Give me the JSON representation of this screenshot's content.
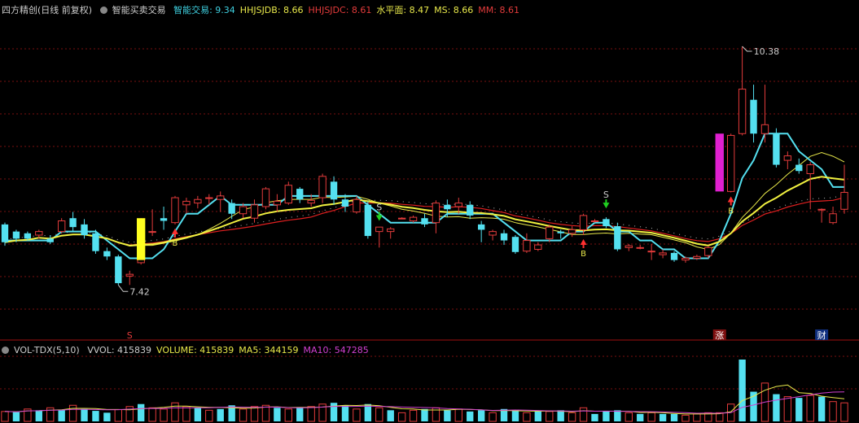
{
  "main_header": {
    "title": "四方精创(日线 前复权)",
    "indicator": "智能买卖交易",
    "items": [
      {
        "label": "智能交易:",
        "value": "9.34",
        "color": "#3fd0e0"
      },
      {
        "label": "HHJSJDB:",
        "value": "8.66",
        "color": "#e8e84a"
      },
      {
        "label": "HHJSJDC:",
        "value": "8.61",
        "color": "#e33b3b"
      },
      {
        "label": "水平面:",
        "value": "8.47",
        "color": "#e8e84a"
      },
      {
        "label": "MS:",
        "value": "8.66",
        "color": "#e8e84a"
      },
      {
        "label": "MM:",
        "value": "8.61",
        "color": "#e33b3b"
      }
    ]
  },
  "vol_header": {
    "indicator": "VOL-TDX(5,10)",
    "items": [
      {
        "label": "VVOL:",
        "value": "415839",
        "color": "#cccccc"
      },
      {
        "label": "VOLUME:",
        "value": "415839",
        "color": "#e8e84a"
      },
      {
        "label": "MA5:",
        "value": "344159",
        "color": "#e8e84a"
      },
      {
        "label": "MA10:",
        "value": "547285",
        "color": "#d040d0"
      }
    ]
  },
  "annotations": {
    "high_label": "10.38",
    "low_label": "7.42",
    "sell_label": "S",
    "buy_label": "B",
    "marker_s": "S",
    "marker_zhang": "涨",
    "marker_cai": "财"
  },
  "colors": {
    "up": "#e33b3b",
    "down": "#54e0f0",
    "cyan_line": "#54e0f0",
    "yellow_line": "#f0f040",
    "red_line": "#e02020",
    "grid": "#7a1010",
    "magenta": "#e020d0"
  },
  "chart_data": {
    "type": "candlestick",
    "candles": [
      [
        8.38,
        8.4,
        8.18,
        8.14
      ],
      [
        8.3,
        8.32,
        8.22,
        8.18
      ],
      [
        8.28,
        8.3,
        8.22,
        8.2
      ],
      [
        8.26,
        8.32,
        8.3,
        8.22
      ],
      [
        8.22,
        8.26,
        8.18,
        8.16
      ],
      [
        8.3,
        8.45,
        8.42,
        8.28
      ],
      [
        8.45,
        8.52,
        8.35,
        8.3
      ],
      [
        8.38,
        8.44,
        8.26,
        8.22
      ],
      [
        8.28,
        8.32,
        8.08,
        8.05
      ],
      [
        8.08,
        8.12,
        8.02,
        7.98
      ],
      [
        8.02,
        8.04,
        7.72,
        7.7
      ],
      [
        7.8,
        7.86,
        7.82,
        7.7
      ],
      [
        7.95,
        8.45,
        8.3,
        7.93
      ],
      [
        8.3,
        8.55,
        8.3,
        8.25
      ],
      [
        8.45,
        8.58,
        8.42,
        8.32
      ],
      [
        8.4,
        8.7,
        8.68,
        8.38
      ],
      [
        8.6,
        8.68,
        8.64,
        8.5
      ],
      [
        8.62,
        8.7,
        8.66,
        8.56
      ],
      [
        8.68,
        8.72,
        8.68,
        8.6
      ],
      [
        8.66,
        8.75,
        8.7,
        8.52
      ],
      [
        8.62,
        8.66,
        8.5,
        8.44
      ],
      [
        8.5,
        8.62,
        8.58,
        8.45
      ],
      [
        8.45,
        8.66,
        8.6,
        8.4
      ],
      [
        8.58,
        8.8,
        8.78,
        8.55
      ],
      [
        8.6,
        8.72,
        8.64,
        8.52
      ],
      [
        8.62,
        8.86,
        8.82,
        8.6
      ],
      [
        8.78,
        8.8,
        8.66,
        8.62
      ],
      [
        8.62,
        8.72,
        8.65,
        8.58
      ],
      [
        8.68,
        8.95,
        8.92,
        8.62
      ],
      [
        8.86,
        8.92,
        8.66,
        8.6
      ],
      [
        8.66,
        8.72,
        8.58,
        8.52
      ],
      [
        8.52,
        8.7,
        8.66,
        8.5
      ],
      [
        8.6,
        8.64,
        8.25,
        8.22
      ],
      [
        8.3,
        8.32,
        8.35,
        8.12
      ],
      [
        8.3,
        8.35,
        8.33,
        8.22
      ],
      [
        8.45,
        8.46,
        8.45,
        8.44
      ],
      [
        8.42,
        8.48,
        8.46,
        8.4
      ],
      [
        8.45,
        8.5,
        8.38,
        8.35
      ],
      [
        8.4,
        8.65,
        8.62,
        8.28
      ],
      [
        8.6,
        8.66,
        8.55,
        8.46
      ],
      [
        8.58,
        8.68,
        8.62,
        8.5
      ],
      [
        8.6,
        8.64,
        8.48,
        8.44
      ],
      [
        8.38,
        8.42,
        8.32,
        8.18
      ],
      [
        8.26,
        8.32,
        8.3,
        8.2
      ],
      [
        8.28,
        8.32,
        8.2,
        8.15
      ],
      [
        8.24,
        8.26,
        8.07,
        8.05
      ],
      [
        8.08,
        8.28,
        8.2,
        8.06
      ],
      [
        8.1,
        8.18,
        8.15,
        8.08
      ],
      [
        8.22,
        8.38,
        8.35,
        8.18
      ],
      [
        8.3,
        8.32,
        8.28,
        8.22
      ],
      [
        8.28,
        8.36,
        8.32,
        8.24
      ],
      [
        8.32,
        8.5,
        8.48,
        8.26
      ],
      [
        8.42,
        8.44,
        8.42,
        8.4
      ],
      [
        8.44,
        8.46,
        8.36,
        8.34
      ],
      [
        8.36,
        8.4,
        8.1,
        8.08
      ],
      [
        8.12,
        8.16,
        8.14,
        8.08
      ],
      [
        8.12,
        8.15,
        8.12,
        8.1
      ],
      [
        8.08,
        8.16,
        8.08,
        7.98
      ],
      [
        8.04,
        8.1,
        8.06,
        8.0
      ],
      [
        8.06,
        8.08,
        7.98,
        7.96
      ],
      [
        7.98,
        8.02,
        8.0,
        7.95
      ],
      [
        8.0,
        8.04,
        8.02,
        7.98
      ],
      [
        8.03,
        8.14,
        8.12,
        8.0
      ],
      [
        8.9,
        8.94,
        8.92,
        8.88
      ],
      [
        8.75,
        9.4,
        9.38,
        8.74
      ],
      [
        9.4,
        10.38,
        9.9,
        9.38
      ],
      [
        9.78,
        9.95,
        9.4,
        9.3
      ],
      [
        9.4,
        9.95,
        9.5,
        9.3
      ],
      [
        9.4,
        9.46,
        9.05,
        9.02
      ],
      [
        9.1,
        9.2,
        9.15,
        9.0
      ],
      [
        9.05,
        9.12,
        8.98,
        8.95
      ],
      [
        8.95,
        9.08,
        9.05,
        8.55
      ],
      [
        8.55,
        8.56,
        8.55,
        8.4
      ],
      [
        8.4,
        8.58,
        8.5,
        8.38
      ],
      [
        8.55,
        9.05,
        8.74,
        8.5
      ]
    ],
    "volume_scale_max": 100,
    "volumes": [
      [
        16,
        0
      ],
      [
        15,
        1
      ],
      [
        20,
        0
      ],
      [
        18,
        1
      ],
      [
        22,
        0
      ],
      [
        19,
        1
      ],
      [
        26,
        0
      ],
      [
        20,
        1
      ],
      [
        17,
        1
      ],
      [
        14,
        1
      ],
      [
        19,
        0
      ],
      [
        24,
        0
      ],
      [
        28,
        1
      ],
      [
        22,
        0
      ],
      [
        20,
        0
      ],
      [
        30,
        0
      ],
      [
        24,
        0
      ],
      [
        22,
        1
      ],
      [
        18,
        0
      ],
      [
        20,
        1
      ],
      [
        26,
        1
      ],
      [
        20,
        0
      ],
      [
        24,
        0
      ],
      [
        26,
        0
      ],
      [
        22,
        1
      ],
      [
        20,
        0
      ],
      [
        22,
        1
      ],
      [
        24,
        0
      ],
      [
        28,
        0
      ],
      [
        30,
        1
      ],
      [
        26,
        1
      ],
      [
        20,
        0
      ],
      [
        28,
        1
      ],
      [
        22,
        0
      ],
      [
        18,
        1
      ],
      [
        14,
        0
      ],
      [
        18,
        0
      ],
      [
        20,
        1
      ],
      [
        22,
        0
      ],
      [
        18,
        1
      ],
      [
        20,
        0
      ],
      [
        16,
        1
      ],
      [
        18,
        1
      ],
      [
        14,
        0
      ],
      [
        20,
        1
      ],
      [
        18,
        1
      ],
      [
        14,
        0
      ],
      [
        16,
        1
      ],
      [
        16,
        0
      ],
      [
        18,
        1
      ],
      [
        14,
        0
      ],
      [
        22,
        0
      ],
      [
        12,
        1
      ],
      [
        16,
        1
      ],
      [
        18,
        1
      ],
      [
        14,
        0
      ],
      [
        12,
        1
      ],
      [
        14,
        0
      ],
      [
        12,
        1
      ],
      [
        12,
        1
      ],
      [
        10,
        0
      ],
      [
        12,
        0
      ],
      [
        14,
        0
      ],
      [
        14,
        0
      ],
      [
        28,
        0
      ],
      [
        100,
        1
      ],
      [
        48,
        1
      ],
      [
        62,
        0
      ],
      [
        44,
        1
      ],
      [
        40,
        0
      ],
      [
        38,
        1
      ],
      [
        42,
        0
      ],
      [
        40,
        1
      ],
      [
        32,
        0
      ],
      [
        30,
        0
      ]
    ],
    "signals": [
      {
        "type": "sell",
        "index": 33
      },
      {
        "type": "sell",
        "index": 53
      },
      {
        "type": "buy",
        "index": 15
      },
      {
        "type": "buy",
        "index": 51
      },
      {
        "type": "buy",
        "index": 64
      }
    ],
    "ylim": [
      7.2,
      10.7
    ]
  }
}
